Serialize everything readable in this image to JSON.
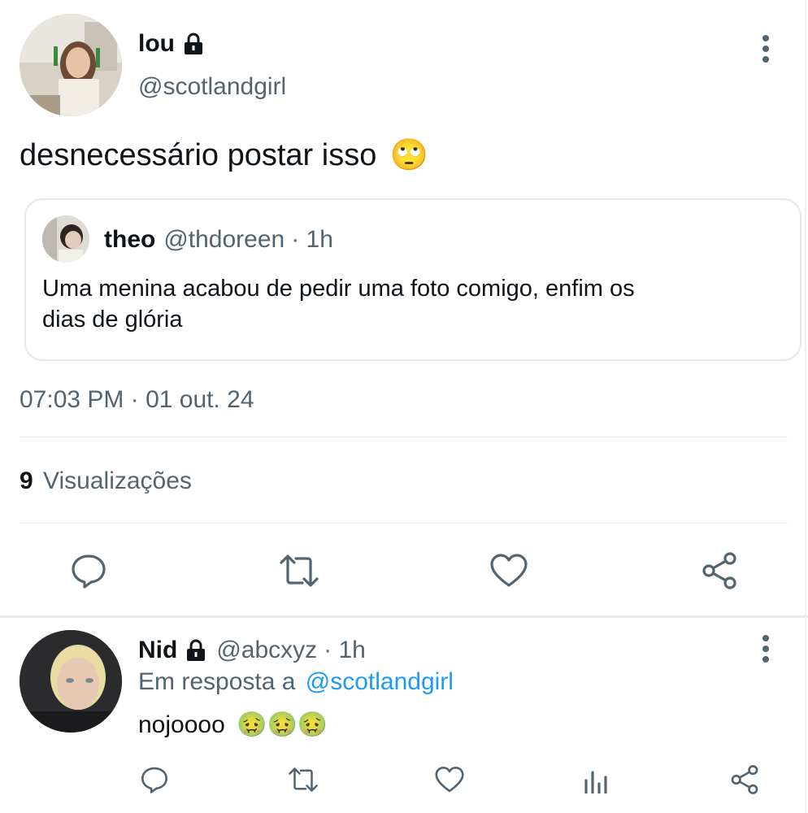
{
  "main_tweet": {
    "author_name": "lou",
    "author_handle": "@scotlandgirl",
    "text": "desnecessário postar isso",
    "emoji": "🙄",
    "timestamp": "07:03 PM · 01 out. 24",
    "views_count": "9",
    "views_label": "Visualizações",
    "quoted": {
      "author_name": "theo",
      "author_handle": "@thdoreen",
      "time": "· 1h",
      "text_line1": "Uma menina acabou de pedir uma foto comigo, enfim os",
      "text_line2": "dias de glória"
    }
  },
  "reply": {
    "author_name": "Nid",
    "author_handle": "@abcxyz",
    "time": "· 1h",
    "reply_prefix": "Em resposta a",
    "reply_to": "@scotlandgirl",
    "text": "nojoooo",
    "emojis": "🤢🤢🤢"
  },
  "colors": {
    "text": "#0f1419",
    "muted": "#536471",
    "link": "#1d9bf0",
    "divider": "#e6e9ec"
  }
}
